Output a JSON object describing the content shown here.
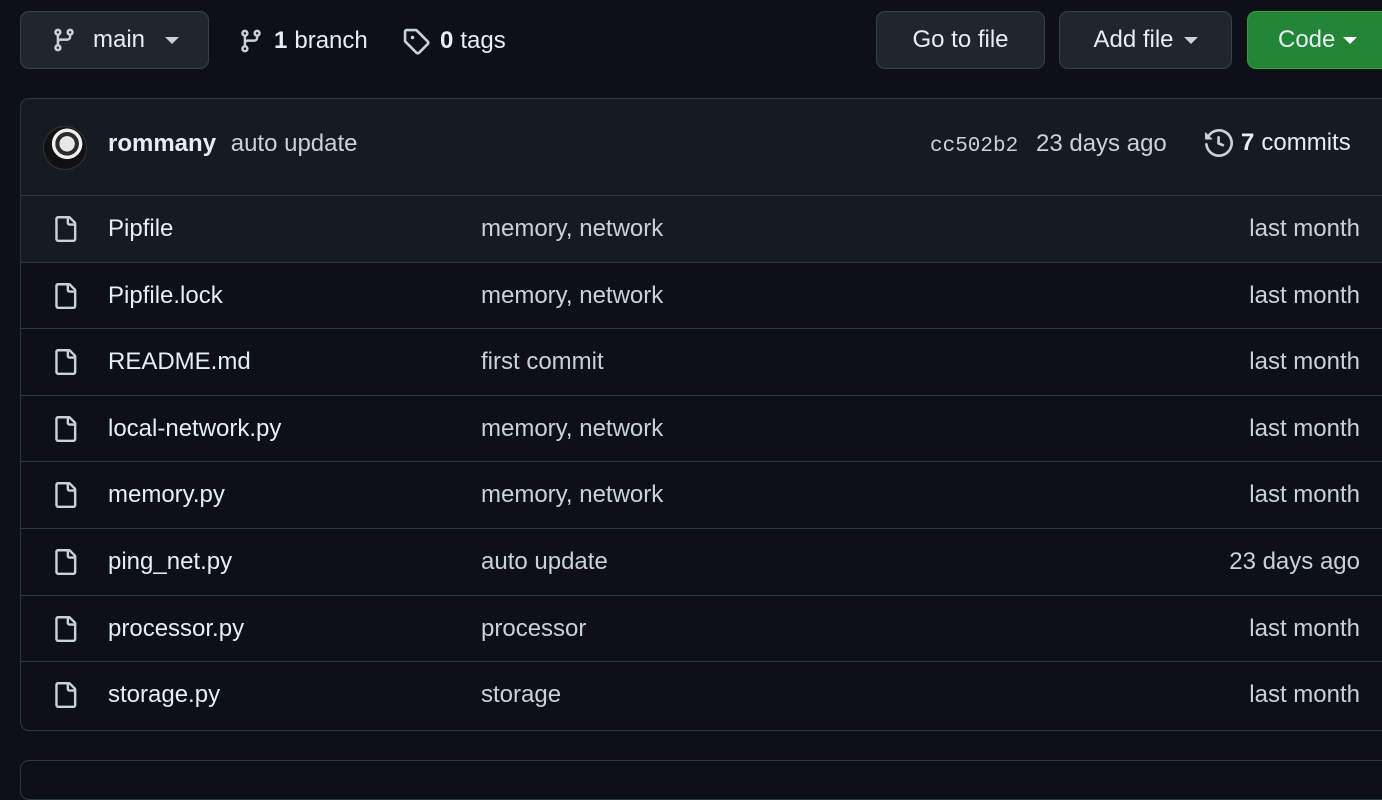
{
  "toolbar": {
    "branch_button": {
      "label": "main"
    },
    "branches": {
      "count": "1",
      "label": "branch"
    },
    "tags": {
      "count": "0",
      "label": "tags"
    },
    "go_to_file": "Go to file",
    "add_file": "Add file",
    "code": "Code",
    "code_color": "#238636"
  },
  "commit": {
    "author": "rommany",
    "message": "auto update",
    "sha": "cc502b2",
    "time": "23 days ago",
    "commits_count": "7",
    "commits_label": "commits"
  },
  "files": [
    {
      "name": "Pipfile",
      "commit": "memory, network",
      "age": "last month"
    },
    {
      "name": "Pipfile.lock",
      "commit": "memory, network",
      "age": "last month"
    },
    {
      "name": "README.md",
      "commit": "first commit",
      "age": "last month"
    },
    {
      "name": "local-network.py",
      "commit": "memory, network",
      "age": "last month"
    },
    {
      "name": "memory.py",
      "commit": "memory, network",
      "age": "last month"
    },
    {
      "name": "ping_net.py",
      "commit": "auto update",
      "age": "23 days ago"
    },
    {
      "name": "processor.py",
      "commit": "processor",
      "age": "last month"
    },
    {
      "name": "storage.py",
      "commit": "storage",
      "age": "last month"
    }
  ]
}
